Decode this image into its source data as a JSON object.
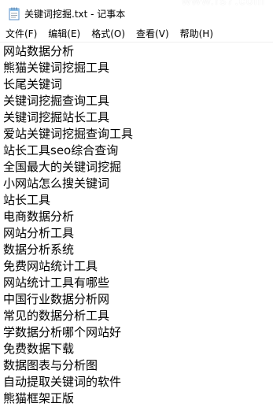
{
  "window": {
    "title": "关键词挖掘.txt - 记事本",
    "watermark": "www.rs7.com"
  },
  "menu": {
    "items": [
      {
        "label": "文件(F)"
      },
      {
        "label": "编辑(E)"
      },
      {
        "label": "格式(O)"
      },
      {
        "label": "查看(V)"
      },
      {
        "label": "帮助(H)"
      }
    ]
  },
  "editor": {
    "lines": [
      "网站数据分析",
      "熊猫关键词挖掘工具",
      "长尾关键词",
      "关键词挖掘查询工具",
      "关键词挖掘站长工具",
      "爱站关键词挖掘查询工具",
      "站长工具seo综合查询",
      "全国最大的关键词挖掘",
      "小网站怎么搜关键词",
      "站长工具",
      "电商数据分析",
      "网站分析工具",
      "数据分析系统",
      "免费网站统计工具",
      "网站统计工具有哪些",
      "中国行业数据分析网",
      "常见的数据分析工具",
      "学数据分析哪个网站好",
      "免费数据下载",
      "数据图表与分析图",
      "自动提取关键词的软件",
      "熊猫框架正版"
    ]
  }
}
